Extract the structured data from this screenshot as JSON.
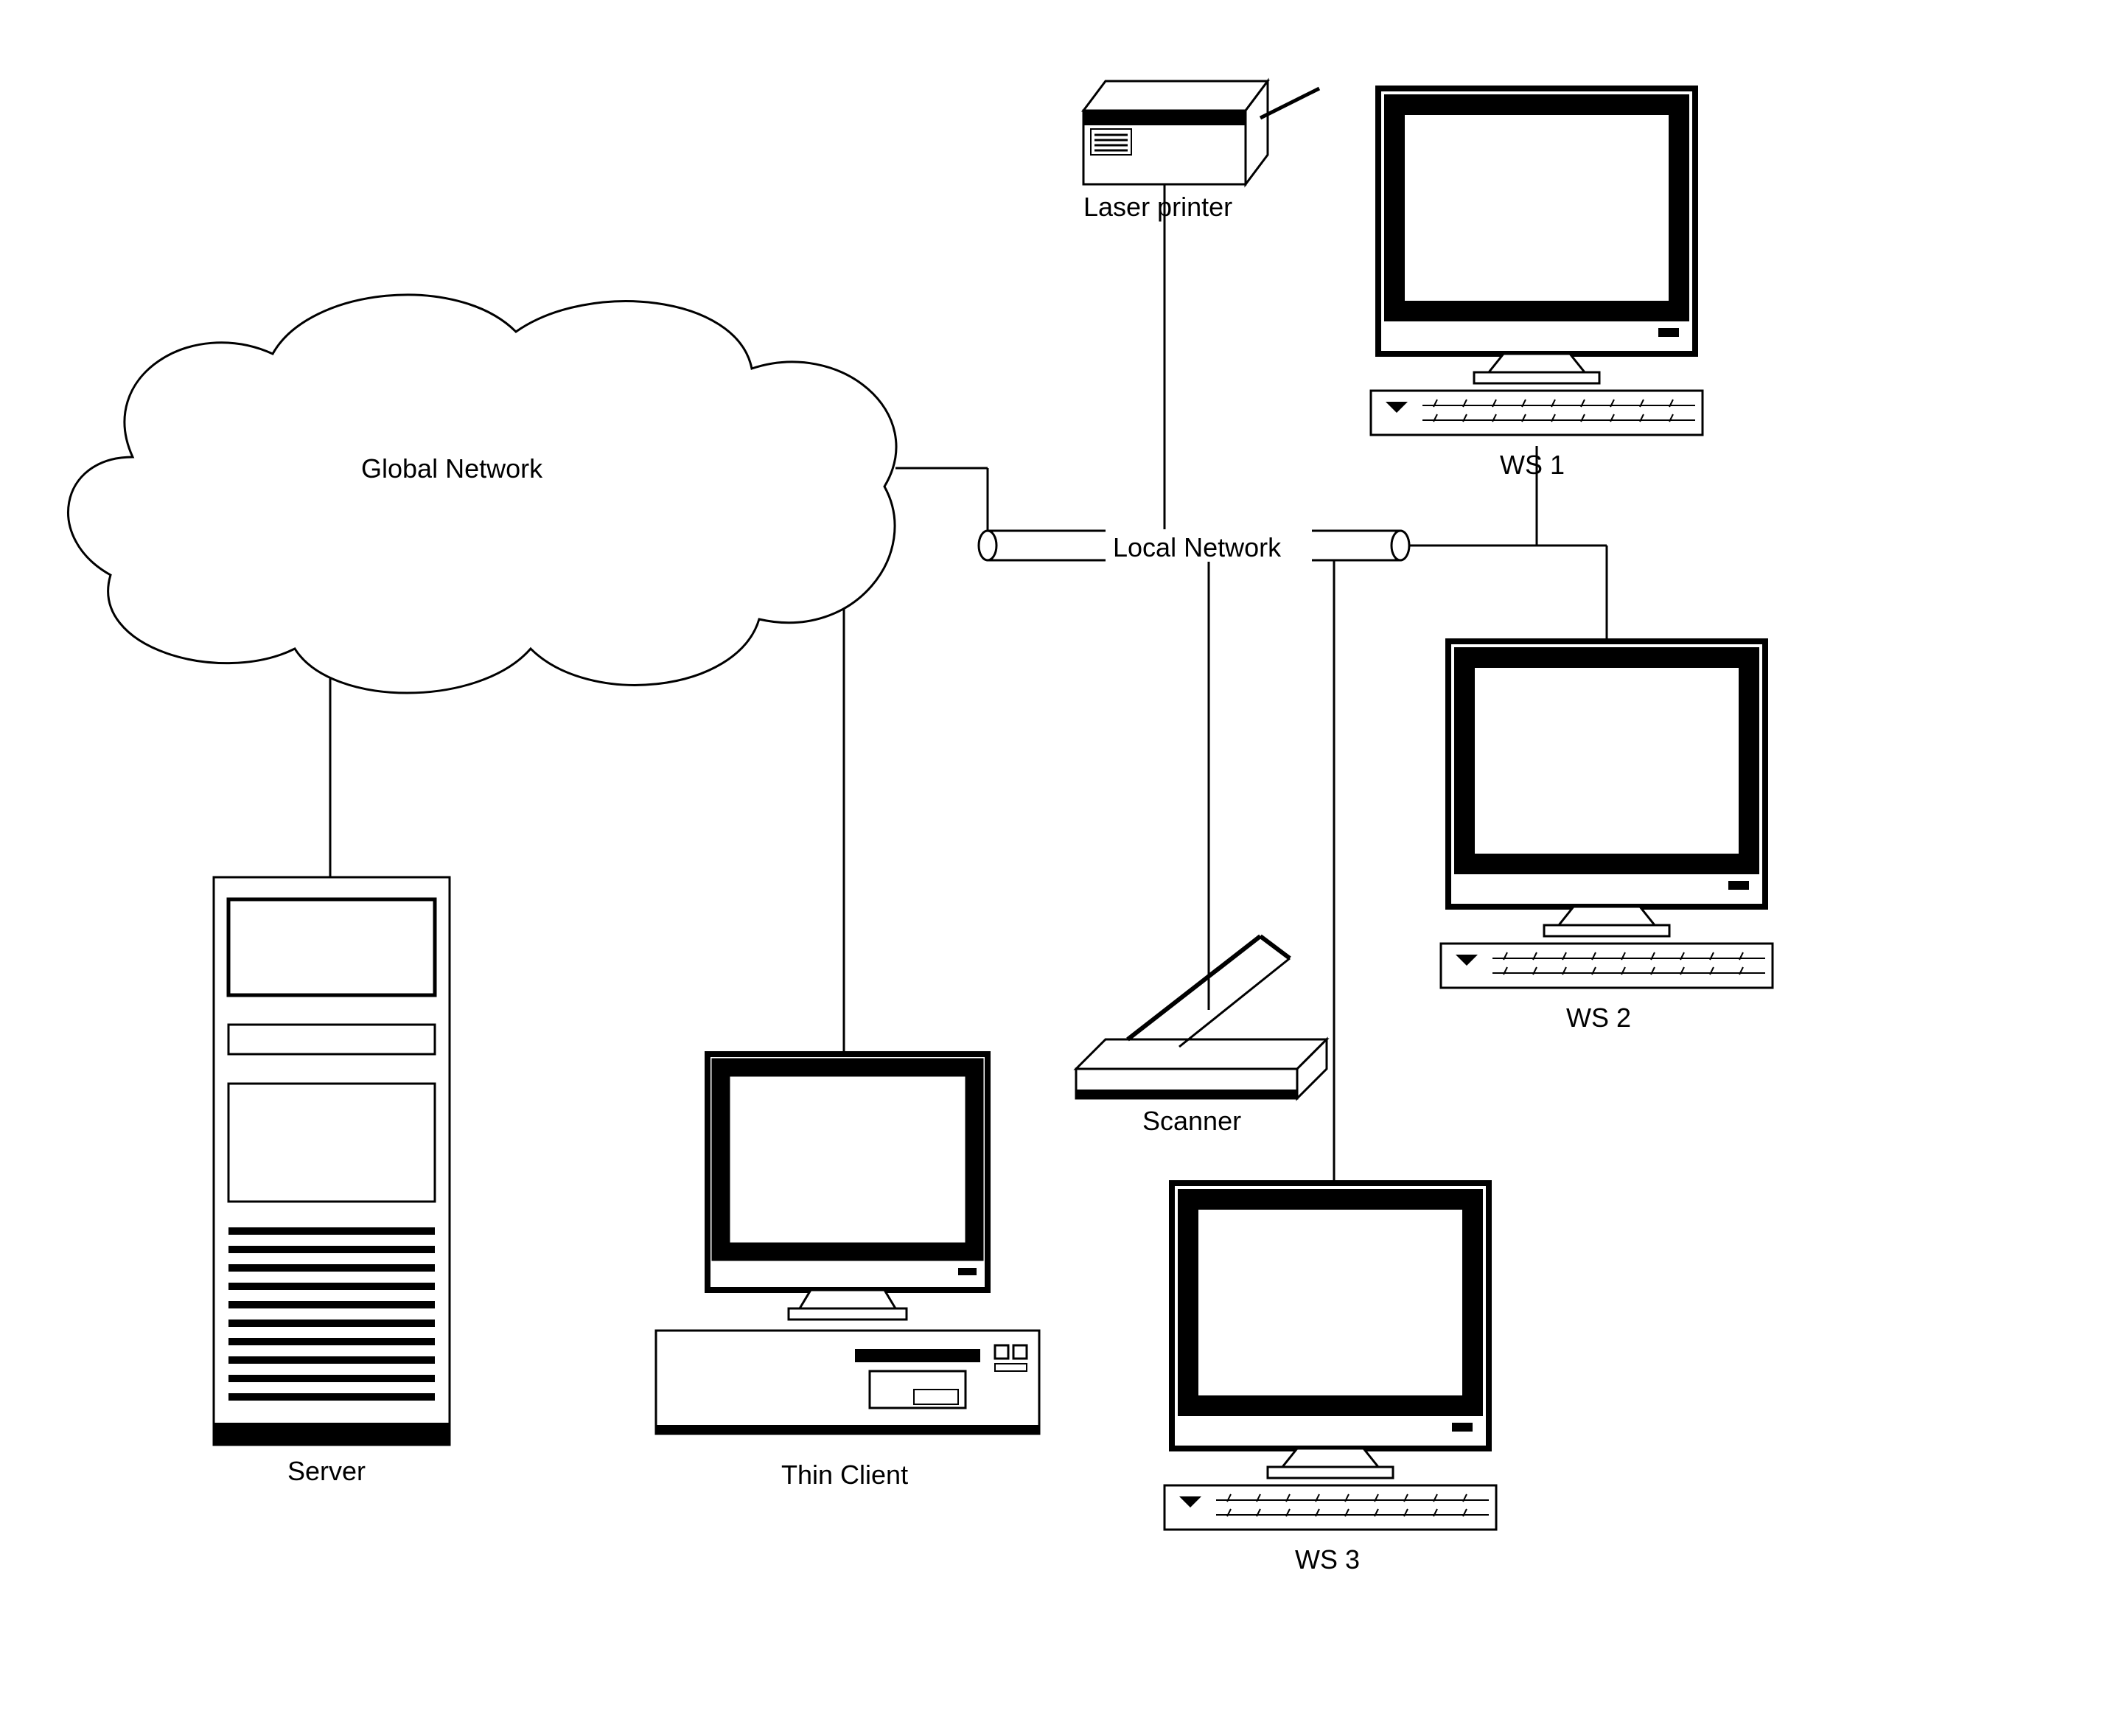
{
  "diagram": {
    "cloud_label": "Global Network",
    "bus_label": "Local Network",
    "nodes": {
      "printer": {
        "label": "Laser printer"
      },
      "server": {
        "label": "Server"
      },
      "thin_client": {
        "label": "Thin Client"
      },
      "scanner": {
        "label": "Scanner"
      },
      "ws1": {
        "label": "WS 1"
      },
      "ws2": {
        "label": "WS 2"
      },
      "ws3": {
        "label": "WS 3"
      }
    }
  }
}
